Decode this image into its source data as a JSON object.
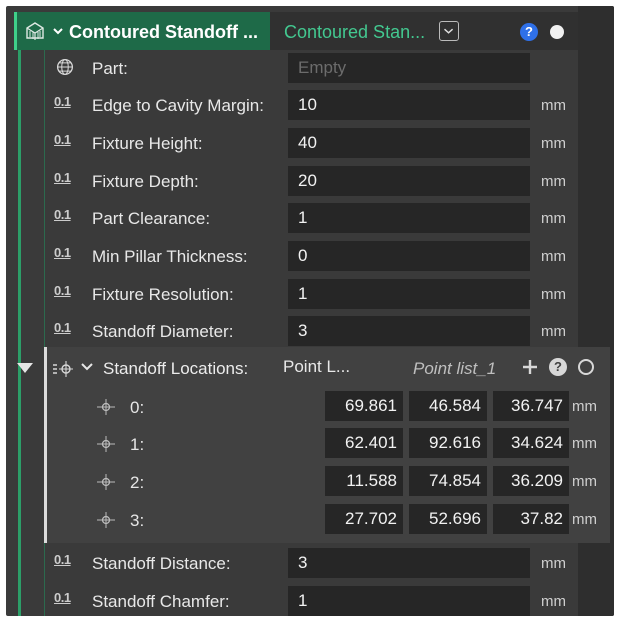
{
  "header": {
    "title": "Contoured Standoff ...",
    "subtitle": "Contoured Stan...",
    "help_label": "?"
  },
  "fields": [
    {
      "label": "Part:",
      "value": "",
      "placeholder": "Empty",
      "unit": ""
    },
    {
      "label": "Edge to Cavity Margin:",
      "value": "10",
      "unit": "mm"
    },
    {
      "label": "Fixture Height:",
      "value": "40",
      "unit": "mm"
    },
    {
      "label": "Fixture Depth:",
      "value": "20",
      "unit": "mm"
    },
    {
      "label": "Part Clearance:",
      "value": "1",
      "unit": "mm"
    },
    {
      "label": "Min Pillar Thickness:",
      "value": "0",
      "unit": "mm"
    },
    {
      "label": "Fixture Resolution:",
      "value": "1",
      "unit": "mm"
    },
    {
      "label": "Standoff Diameter:",
      "value": "3",
      "unit": "mm"
    }
  ],
  "number_icon_label": "0.1",
  "standoff_locations": {
    "label": "Standoff Locations:",
    "mode": "Point L...",
    "list_name": "Point list_1",
    "help_label": "?",
    "points": [
      {
        "index": "0:",
        "x": "69.861",
        "y": "46.584",
        "z": "36.747",
        "unit": "mm"
      },
      {
        "index": "1:",
        "x": "62.401",
        "y": "92.616",
        "z": "34.624",
        "unit": "mm"
      },
      {
        "index": "2:",
        "x": "11.588",
        "y": "74.854",
        "z": "36.209",
        "unit": "mm"
      },
      {
        "index": "3:",
        "x": "27.702",
        "y": "52.696",
        "z": "37.82",
        "unit": "mm"
      }
    ]
  },
  "bottom_fields": [
    {
      "label": "Standoff Distance:",
      "value": "3",
      "unit": "mm"
    },
    {
      "label": "Standoff Chamfer:",
      "value": "1",
      "unit": "mm"
    }
  ],
  "colors": {
    "accent_green": "#2c9e68",
    "header_active": "#1e6a48",
    "help_blue": "#2f70e8"
  },
  "icons": {
    "feature": "contoured-standoff-icon",
    "part": "globe-icon",
    "number": "numeric-parameter-icon",
    "point": "point-crosshair-icon"
  }
}
